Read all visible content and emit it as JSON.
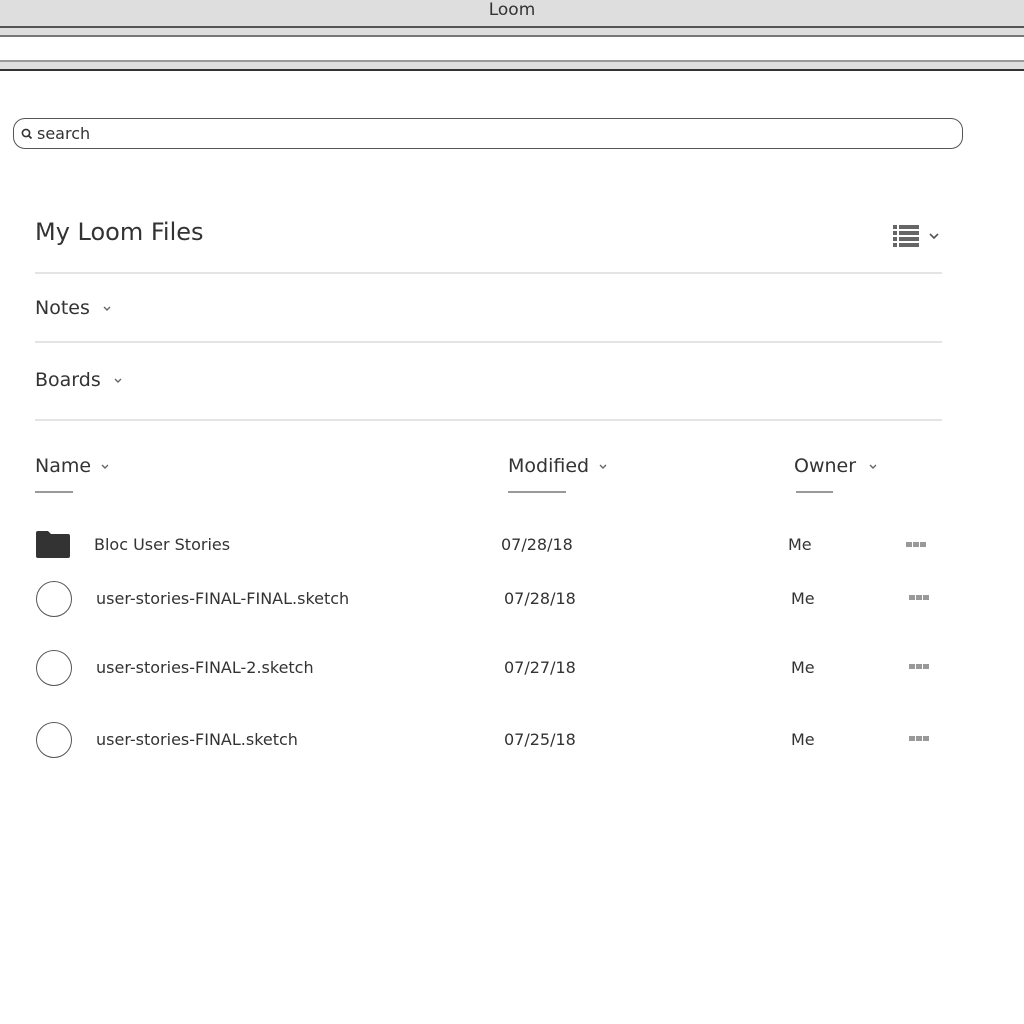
{
  "window": {
    "title": "Loom"
  },
  "search": {
    "placeholder": "search",
    "value": ""
  },
  "header": {
    "title": "My Loom Files",
    "view_icon": "list-view-icon"
  },
  "groups": [
    {
      "label": "Notes",
      "icon": "chevron-down-icon"
    },
    {
      "label": "Boards",
      "icon": "chevron-down-icon"
    }
  ],
  "columns": [
    {
      "label": "Name",
      "icon": "chevron-down-icon"
    },
    {
      "label": "Modified",
      "icon": "chevron-down-icon"
    },
    {
      "label": "Owner",
      "icon": "chevron-down-icon"
    }
  ],
  "files": [
    {
      "icon": "folder-icon",
      "name": "Bloc User Stories",
      "modified": "07/28/18",
      "owner": "Me",
      "actions_icon": "more-icon"
    },
    {
      "icon": "file-circle-icon",
      "name": "user-stories-FINAL-FINAL.sketch",
      "modified": "07/28/18",
      "owner": "Me",
      "actions_icon": "more-icon"
    },
    {
      "icon": "file-circle-icon",
      "name": "user-stories-FINAL-2.sketch",
      "modified": "07/27/18",
      "owner": "Me",
      "actions_icon": "more-icon"
    },
    {
      "icon": "file-circle-icon",
      "name": "user-stories-FINAL.sketch",
      "modified": "07/25/18",
      "owner": "Me",
      "actions_icon": "more-icon"
    }
  ]
}
